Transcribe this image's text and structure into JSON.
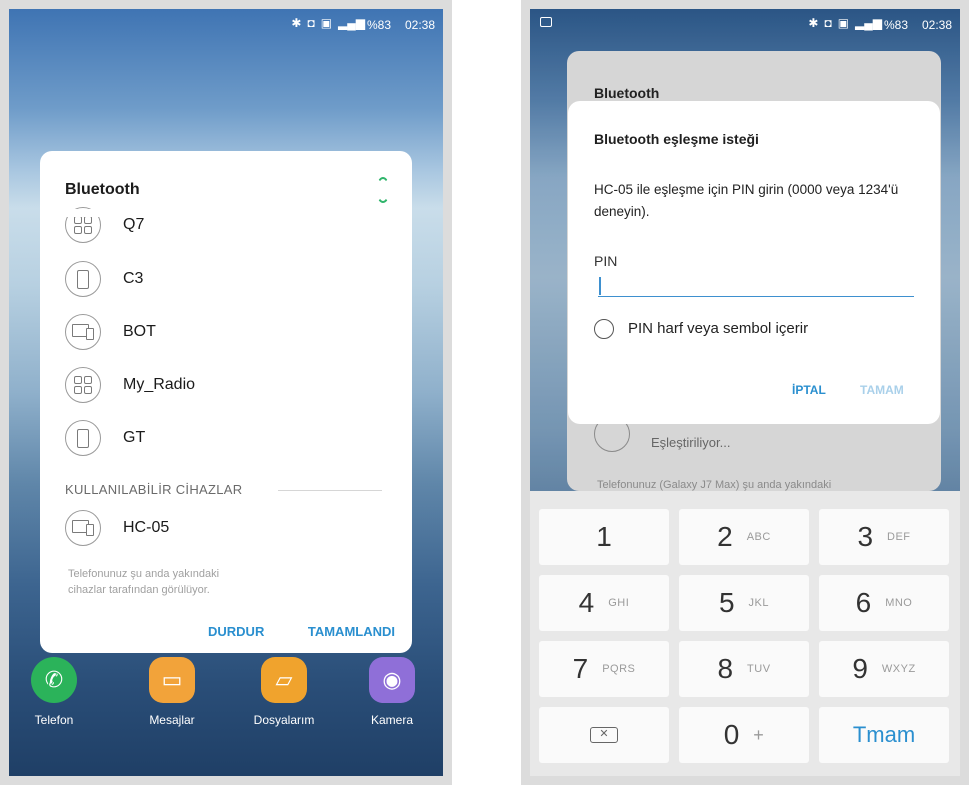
{
  "left": {
    "status": {
      "battery": "%83",
      "time": "02:38"
    },
    "dialog": {
      "title": "Bluetooth",
      "paired_devices": [
        {
          "label": "Q7",
          "icon": "grid-device-icon"
        },
        {
          "label": "C3",
          "icon": "phone-icon"
        },
        {
          "label": "BOT",
          "icon": "tablet-icon"
        },
        {
          "label": "My_Radio",
          "icon": "grid-device-icon"
        },
        {
          "label": "GT",
          "icon": "phone-icon"
        }
      ],
      "available_header": "KULLANILABİLİR CİHAZLAR",
      "available_devices": [
        {
          "label": "HC-05",
          "icon": "tablet-icon"
        }
      ],
      "note_line1": "Telefonunuz şu anda yakındaki",
      "note_line2": "cihazlar tarafından görülüyor.",
      "stop_button": "DURDUR",
      "done_button": "TAMAMLANDI"
    },
    "dock": [
      {
        "label": "Telefon",
        "icon": "phone-call-icon",
        "color": "#2bb35a"
      },
      {
        "label": "Mesajlar",
        "icon": "message-icon",
        "color": "#f2a33a"
      },
      {
        "label": "Dosyalarım",
        "icon": "folder-icon",
        "color": "#f0a32d"
      },
      {
        "label": "Kamera",
        "icon": "camera-icon",
        "color": "#8f6fd8"
      }
    ]
  },
  "right": {
    "status": {
      "battery": "%83",
      "time": "02:38"
    },
    "background_dialog": {
      "title": "Bluetooth",
      "pairing_status": "Eşleştiriliyor...",
      "note": "Telefonunuz (Galaxy J7 Max) şu anda yakındaki"
    },
    "pin_dialog": {
      "title": "Bluetooth eşleşme isteği",
      "message": "HC-05 ile eşleşme için PIN girin (0000 veya 1234'ü deneyin).",
      "pin_label": "PIN",
      "pin_value": "",
      "option_label": "PIN harf veya sembol içerir",
      "cancel_button": "İPTAL",
      "ok_button": "TAMAM"
    },
    "keypad": {
      "keys": [
        {
          "digit": "1",
          "letters": ""
        },
        {
          "digit": "2",
          "letters": "ABC"
        },
        {
          "digit": "3",
          "letters": "DEF"
        },
        {
          "digit": "4",
          "letters": "GHI"
        },
        {
          "digit": "5",
          "letters": "JKL"
        },
        {
          "digit": "6",
          "letters": "MNO"
        },
        {
          "digit": "7",
          "letters": "PQRS"
        },
        {
          "digit": "8",
          "letters": "TUV"
        },
        {
          "digit": "9",
          "letters": "WXYZ"
        }
      ],
      "zero": "0",
      "plus": "+",
      "done_key": "Tmam"
    }
  }
}
